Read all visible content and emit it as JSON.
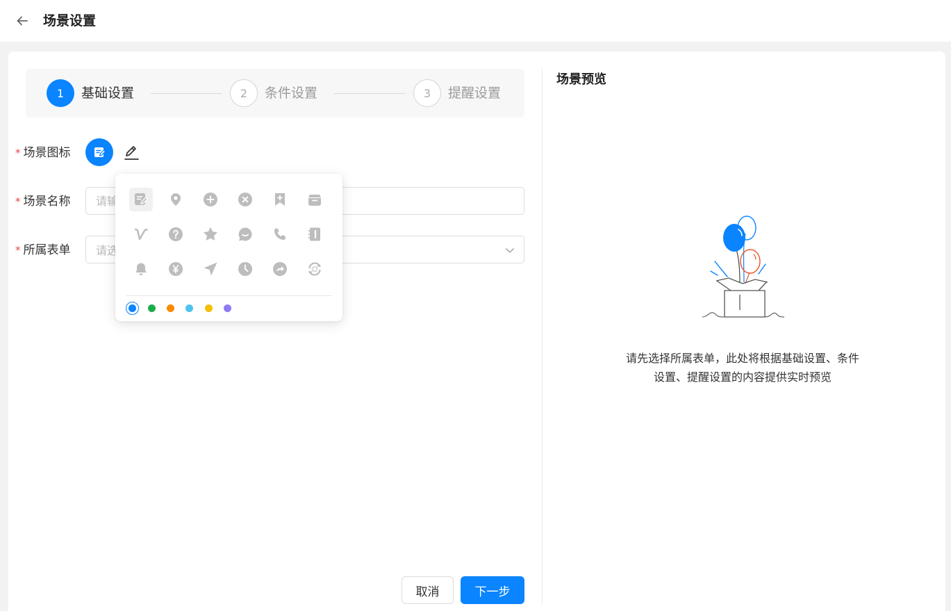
{
  "header": {
    "title": "场景设置"
  },
  "steps": [
    {
      "number": "1",
      "label": "基础设置",
      "state": "active"
    },
    {
      "number": "2",
      "label": "条件设置",
      "state": "idle"
    },
    {
      "number": "3",
      "label": "提醒设置",
      "state": "idle"
    }
  ],
  "form": {
    "icon_label": "场景图标",
    "name_label": "场景名称",
    "name_placeholder": "请输入场景名称",
    "form_label": "所属表单",
    "form_placeholder": "请选择所属表单",
    "required_mark": "*"
  },
  "icon_picker": {
    "icons": [
      "note-edit-icon",
      "location-pin-icon",
      "plus-circle-icon",
      "close-circle-icon",
      "bookmark-add-icon",
      "archive-box-icon",
      "v-letter-icon",
      "question-circle-icon",
      "star-icon",
      "chat-smile-icon",
      "phone-icon",
      "contact-book-icon",
      "bell-icon",
      "yen-circle-icon",
      "send-arrow-icon",
      "clock-icon",
      "share-forward-icon",
      "refresh-globe-icon"
    ],
    "selected_index": 0,
    "colors": [
      "#0a84ff",
      "#1aad4b",
      "#ff8a00",
      "#4fc3f0",
      "#f5c000",
      "#8f7af2"
    ],
    "selected_color_index": 0,
    "icon_color": "#bdbdbd"
  },
  "actions": {
    "cancel_label": "取消",
    "next_label": "下一步"
  },
  "preview": {
    "title": "场景预览",
    "empty_text_line1": "请先选择所属表单，此处将根据基础设置、条件",
    "empty_text_line2": "设置、提醒设置的内容提供实时预览"
  },
  "theme": {
    "accent": "#0a84ff",
    "required": "#e5484d"
  }
}
